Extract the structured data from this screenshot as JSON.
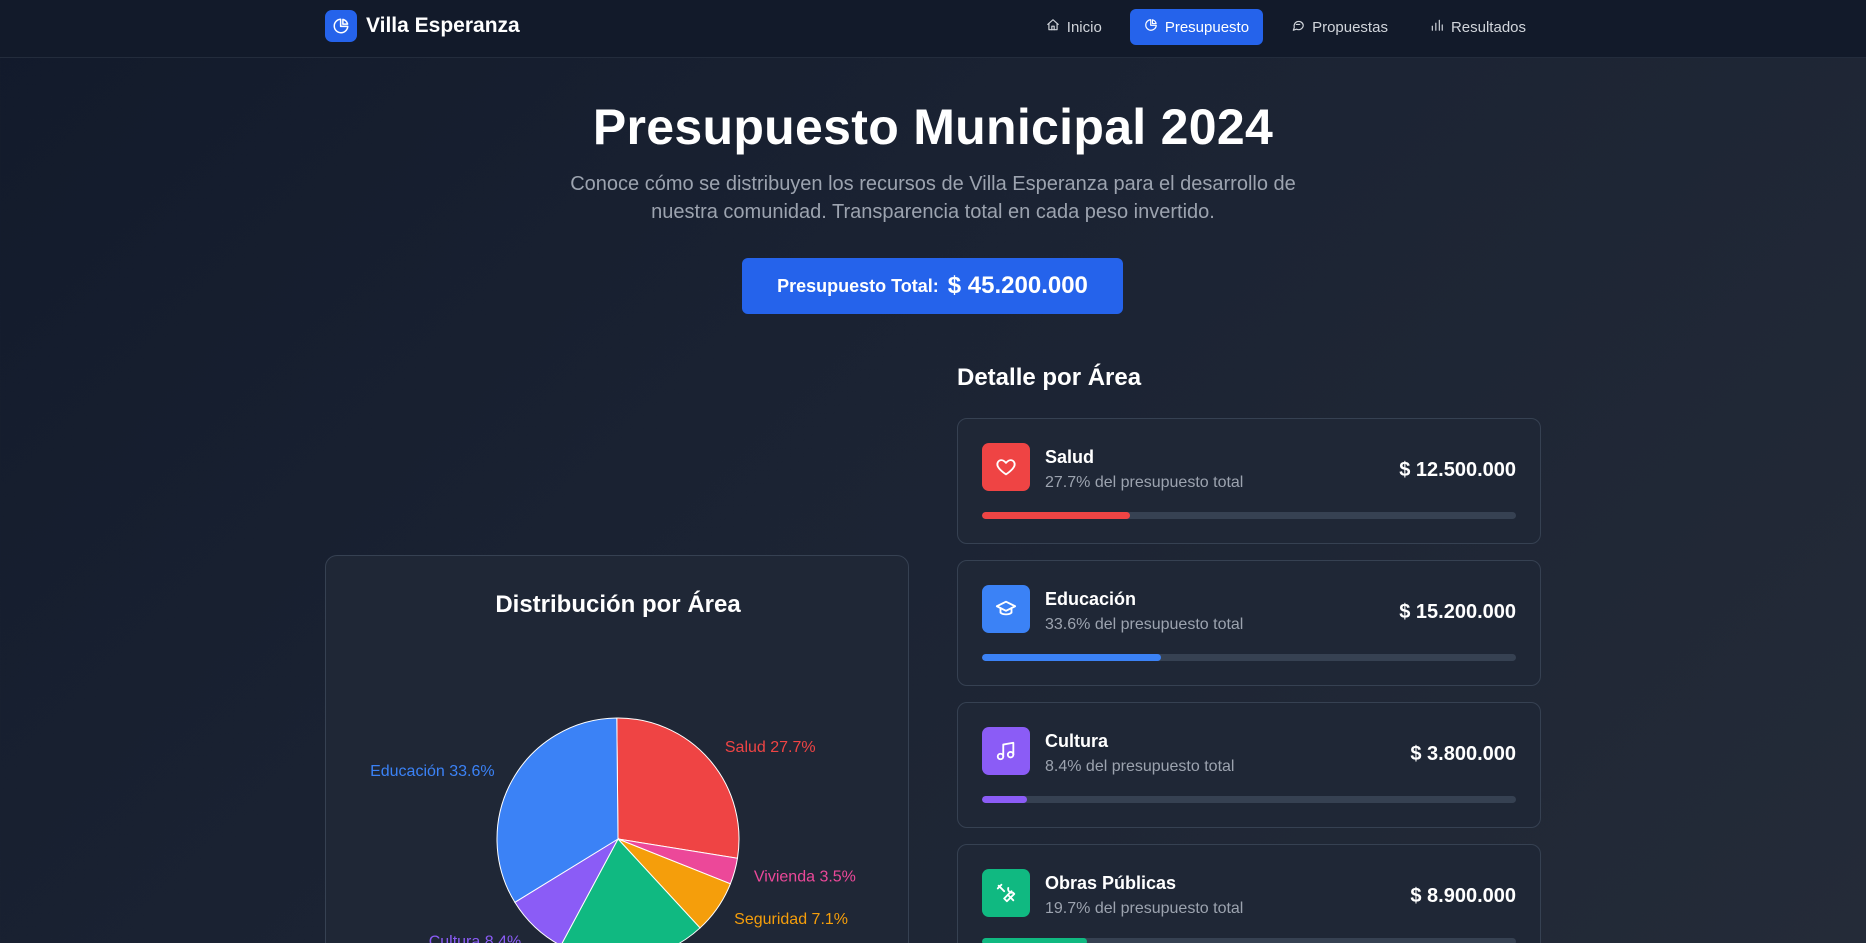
{
  "brand": {
    "name": "Villa Esperanza"
  },
  "nav": [
    {
      "label": "Inicio",
      "icon": "home-icon",
      "active": false
    },
    {
      "label": "Presupuesto",
      "icon": "pie-chart-icon",
      "active": true
    },
    {
      "label": "Propuestas",
      "icon": "message-icon",
      "active": false
    },
    {
      "label": "Resultados",
      "icon": "bar-chart-icon",
      "active": false
    }
  ],
  "hero": {
    "title": "Presupuesto Municipal 2024",
    "subtitle": "Conoce cómo se distribuyen los recursos de Villa Esperanza para el desarrollo de nuestra comunidad. Transparencia total en cada peso invertido.",
    "total_label": "Presupuesto Total:",
    "total_value": "$ 45.200.000"
  },
  "chart_card": {
    "title": "Distribución por Área"
  },
  "detail": {
    "title": "Detalle por Área",
    "areas": [
      {
        "name": "Salud",
        "pct_text": "27.7% del presupuesto total",
        "amount": "$ 12.500.000",
        "pct": 27.7,
        "color": "#ef4444",
        "icon": "heart-icon"
      },
      {
        "name": "Educación",
        "pct_text": "33.6% del presupuesto total",
        "amount": "$ 15.200.000",
        "pct": 33.6,
        "color": "#3b82f6",
        "icon": "graduation-cap-icon"
      },
      {
        "name": "Cultura",
        "pct_text": "8.4% del presupuesto total",
        "amount": "$ 3.800.000",
        "pct": 8.4,
        "color": "#8b5cf6",
        "icon": "music-icon"
      },
      {
        "name": "Obras Públicas",
        "pct_text": "19.7% del presupuesto total",
        "amount": "$ 8.900.000",
        "pct": 19.7,
        "color": "#10b981",
        "icon": "tools-icon"
      }
    ]
  },
  "chart_data": {
    "type": "pie",
    "title": "Distribución por Área",
    "slices": [
      {
        "label": "Salud",
        "value": 27.7,
        "color": "#ef4444",
        "label_text": "Salud 27.7%"
      },
      {
        "label": "Vivienda",
        "value": 3.5,
        "color": "#ec4899",
        "label_text": "Vivienda 3.5%"
      },
      {
        "label": "Seguridad",
        "value": 7.1,
        "color": "#f59e0b",
        "label_text": "Seguridad 7.1%"
      },
      {
        "label": "Obras Públicas",
        "value": 19.7,
        "color": "#10b981",
        "label_text": ""
      },
      {
        "label": "Cultura",
        "value": 8.4,
        "color": "#8b5cf6",
        "label_text": "Cultura 8.4%"
      },
      {
        "label": "Educación",
        "value": 33.6,
        "color": "#3b82f6",
        "label_text": "Educación 33.6%"
      }
    ]
  }
}
